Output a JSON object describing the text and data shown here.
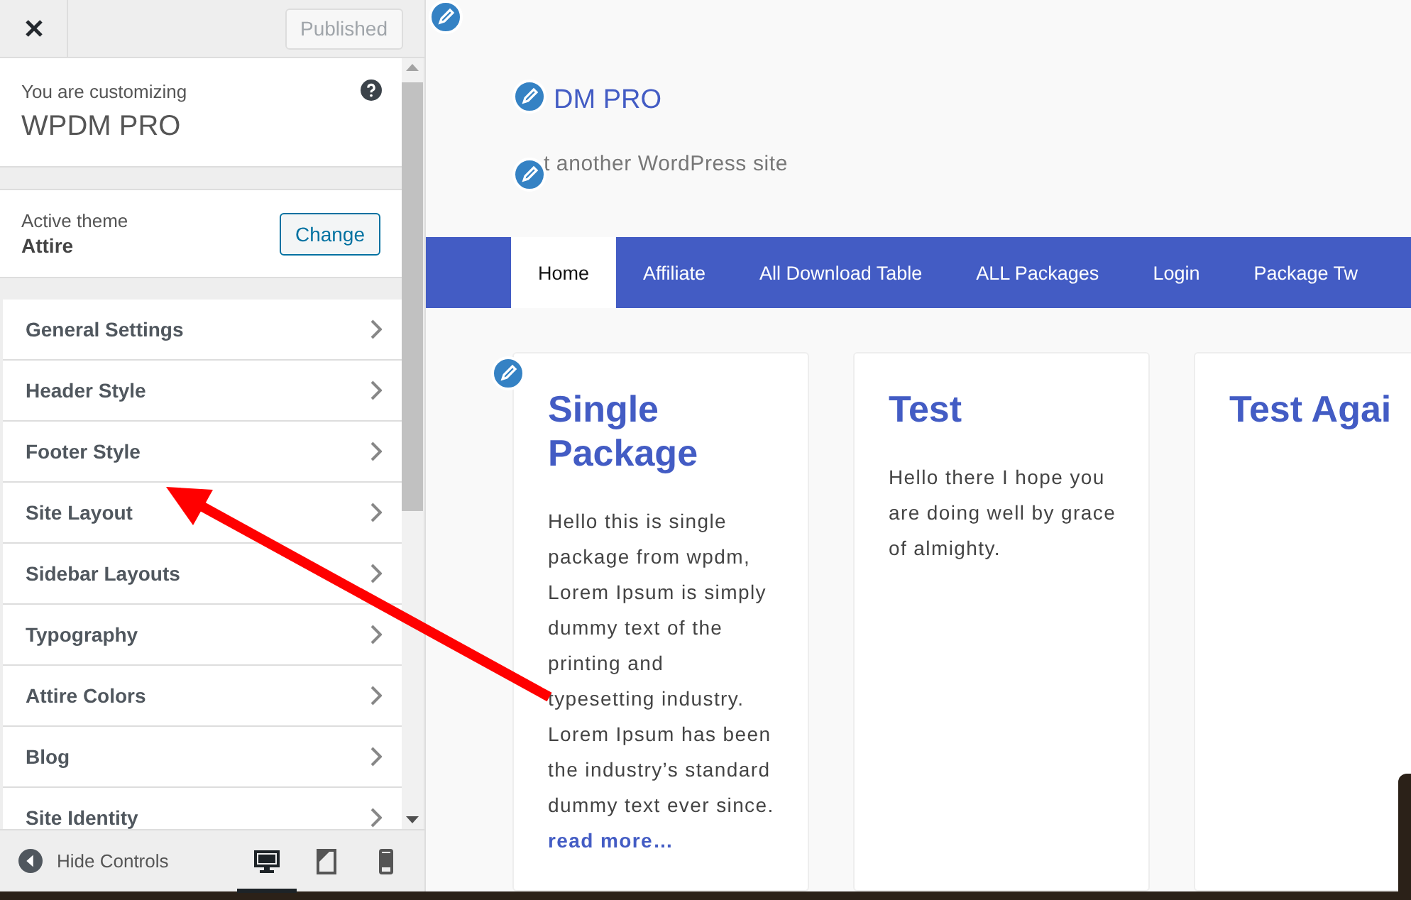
{
  "topbar": {
    "publish_button": "Published"
  },
  "info": {
    "label": "You are customizing",
    "site": "WPDM PRO"
  },
  "theme": {
    "label": "Active theme",
    "name": "Attire",
    "button": "Change"
  },
  "sections": [
    {
      "label": "General Settings"
    },
    {
      "label": "Header Style"
    },
    {
      "label": "Footer Style"
    },
    {
      "label": "Site Layout"
    },
    {
      "label": "Sidebar Layouts"
    },
    {
      "label": "Typography"
    },
    {
      "label": "Attire Colors"
    },
    {
      "label": "Blog"
    },
    {
      "label": "Site Identity"
    }
  ],
  "footer": {
    "hide_controls": "Hide Controls",
    "devices": [
      {
        "kind": "desktop",
        "selected": true
      },
      {
        "kind": "tablet",
        "selected": false
      },
      {
        "kind": "mobile",
        "selected": false
      }
    ]
  },
  "preview": {
    "site_title": "DM PRO",
    "tagline": "t another WordPress site",
    "nav": [
      {
        "label": "Home",
        "selected": true
      },
      {
        "label": "Affiliate",
        "selected": false
      },
      {
        "label": "All Download Table",
        "selected": false
      },
      {
        "label": "ALL Packages",
        "selected": false
      },
      {
        "label": "Login",
        "selected": false
      },
      {
        "label": "Package Tw",
        "selected": false
      }
    ],
    "posts": [
      {
        "title": "Single Package",
        "body": "Hello this is single package from wpdm, Lorem Ipsum is simply dummy text of the printing and typesetting industry. Lorem Ipsum has been the industry’s standard dummy text ever since.",
        "link": "read more…"
      },
      {
        "title": "Test",
        "body": "Hello there I hope you are doing well by grace of almighty."
      },
      {
        "title": "Test Agai"
      }
    ]
  }
}
